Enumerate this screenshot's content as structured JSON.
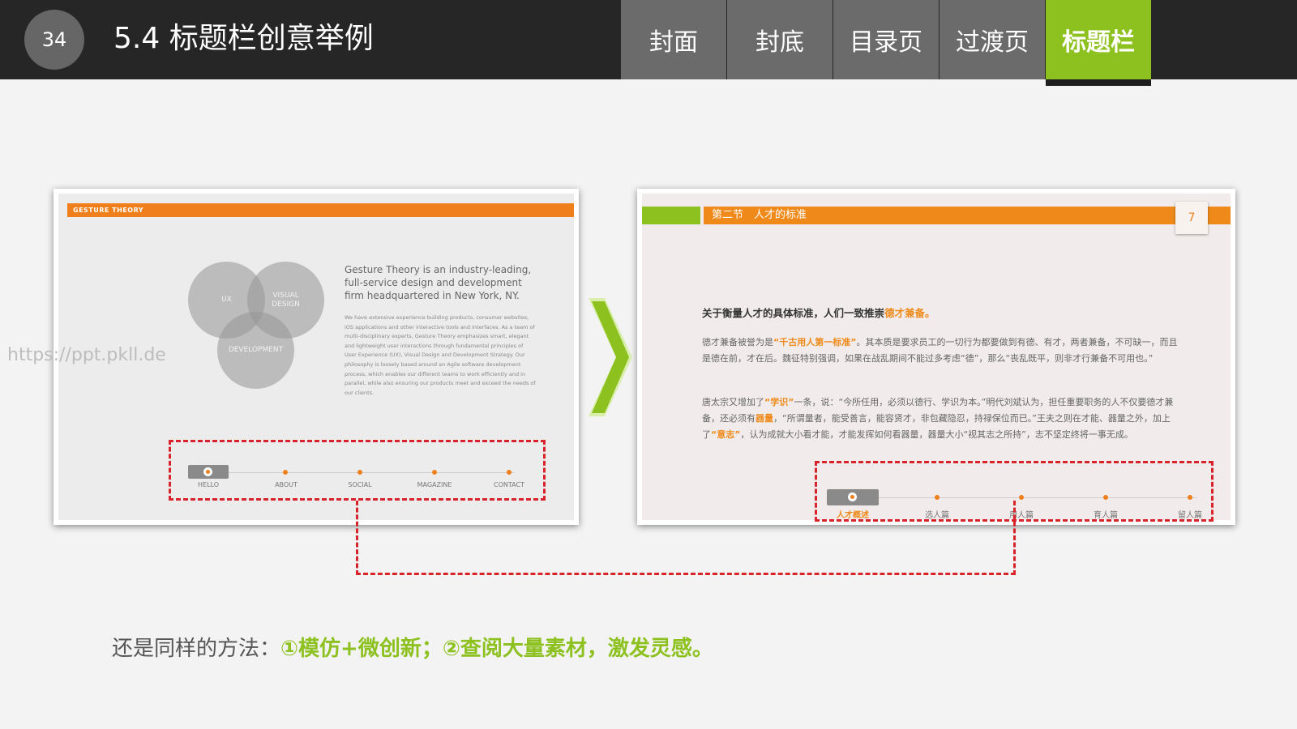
{
  "header": {
    "page_number": "34",
    "title": "5.4 标题栏创意举例",
    "tabs": [
      {
        "label": "封面"
      },
      {
        "label": "封底"
      },
      {
        "label": "目录页"
      },
      {
        "label": "过渡页"
      },
      {
        "label": "标题栏",
        "active": true
      }
    ]
  },
  "left_slide": {
    "header": "GESTURE THEORY",
    "venn": [
      "UX",
      "VISUAL DESIGN",
      "DEVELOPMENT"
    ],
    "lead": "Gesture Theory is an industry-leading, full-service design and development firm headquartered in New York, NY.",
    "body": "We have extensive experience building products, consumer websites, iOS applications and other interactive tools and interfaces. As a team of multi-disciplinary experts, Gesture Theory emphasizes smart, elegant and lightweight user interactions through fundamental principles of User Experience (UX), Visual Design and Development Strategy. Our philosophy is loosely based around an Agile software development process, which enables our different teams to work efficiently and in parallel, while also ensuring our products meet and exceed the needs of our clients.",
    "nav": [
      "HELLO",
      "ABOUT",
      "SOCIAL",
      "MAGAZINE",
      "CONTACT"
    ]
  },
  "right_slide": {
    "header": "第二节　人才的标准",
    "page": "7",
    "intro": "关于衡量人才的具体标准，人们一致推崇",
    "intro_highlight": "德才兼备。",
    "p1": {
      "a": "德才兼备被誉为是",
      "h1": "“千古用人第一标准”",
      "b": "。其本质是要求员工的一切行为都要做到有德、有才，两者兼备，不可缺一，而且是德在前，才在后。魏征特别强调，如果在战乱期间不能过多考虑“德”，那么“丧乱既平，则非才行兼备不可用也。”"
    },
    "p2": {
      "a": "唐太宗又增加了",
      "h1": "“学识”",
      "b": "一条，说：“今所任用，必须以德行、学识为本。”明代刘斌认为，担任重要职务的人不仅要德才兼备，还必须有",
      "h2": "器量",
      "c": "，“所谓量者，能受善言，能容贤才，非包藏隐忍，持禄保位而已。”王夫之则在才能、器量之外，加上了",
      "h3": "“意志”",
      "d": "，认为成就大小看才能，才能发挥如何看器量，器量大小“视其志之所持”，志不坚定终将一事无成。"
    },
    "nav": [
      "人才概述",
      "选人篇",
      "用人篇",
      "育人篇",
      "留人篇"
    ]
  },
  "watermark": "https://ppt.pkll.de",
  "caption": {
    "lead": "还是同样的方法：",
    "emphasis": "①模仿+微创新；②查阅大量素材，激发灵感。"
  },
  "colors": {
    "accent_green": "#8cc11f",
    "accent_orange": "#ef7f1a",
    "dash_red": "#d8232a",
    "topbar": "#262626"
  }
}
